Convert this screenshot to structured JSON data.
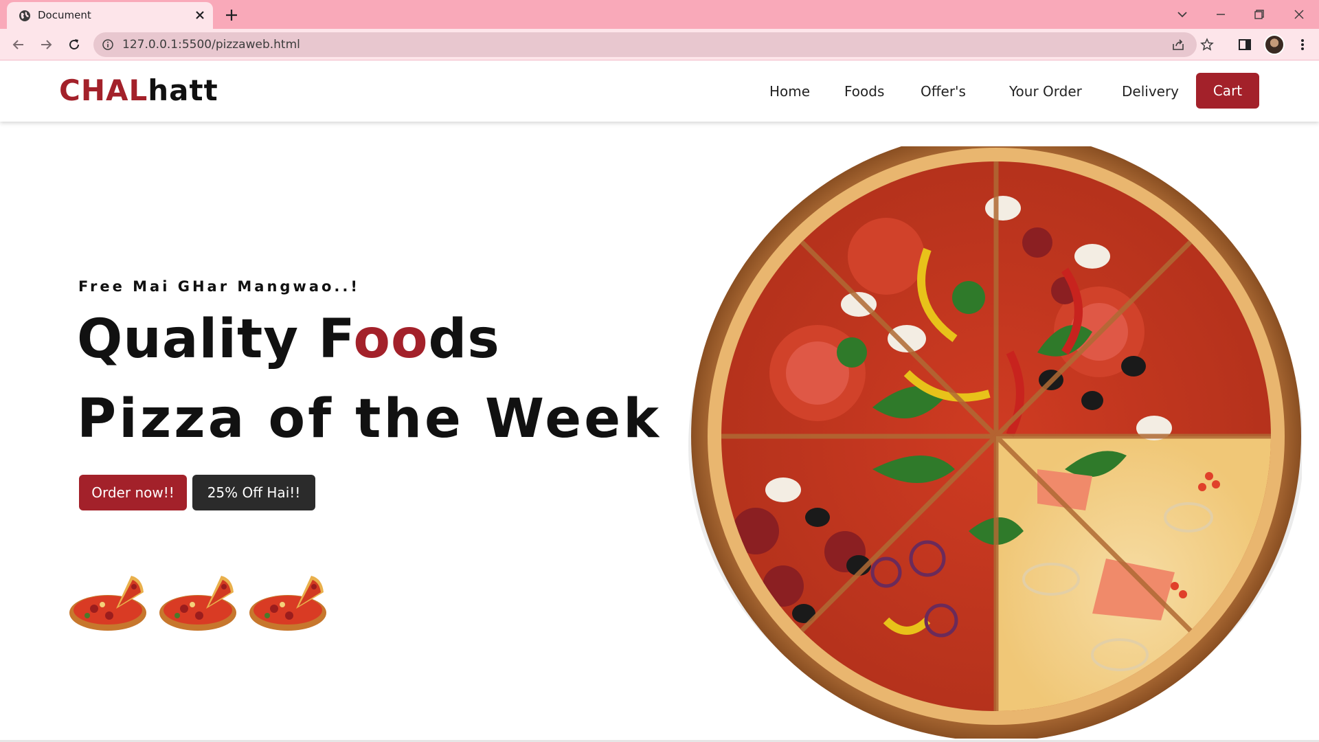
{
  "browser": {
    "tab_title": "Document",
    "url": "127.0.0.1:5500/pizzaweb.html"
  },
  "header": {
    "logo_part1": "CHAL",
    "logo_part2": "hatt",
    "nav": [
      "Home",
      "Foods",
      "Offer's",
      "Your Order",
      "Delivery"
    ],
    "cart_label": "Cart"
  },
  "hero": {
    "tagline": "Free Mai GHar Mangwao..!",
    "headline1_pre": "Quality F",
    "headline1_accent": "oo",
    "headline1_post": "ds",
    "headline2": "Pizza of the Week",
    "order_button": "Order now!!",
    "offer_button": "25% Off Hai!!"
  },
  "colors": {
    "accent": "#a3212a",
    "dark_button": "#2b2b2b",
    "tab_strip": "#f9a9b9"
  },
  "icons": [
    "globe-icon",
    "close-icon",
    "plus-icon",
    "chevron-down-icon",
    "minimize-icon",
    "restore-icon",
    "window-close-icon",
    "back-icon",
    "forward-icon",
    "reload-icon",
    "info-icon",
    "share-icon",
    "star-icon",
    "side-panel-icon",
    "kebab-menu-icon"
  ]
}
